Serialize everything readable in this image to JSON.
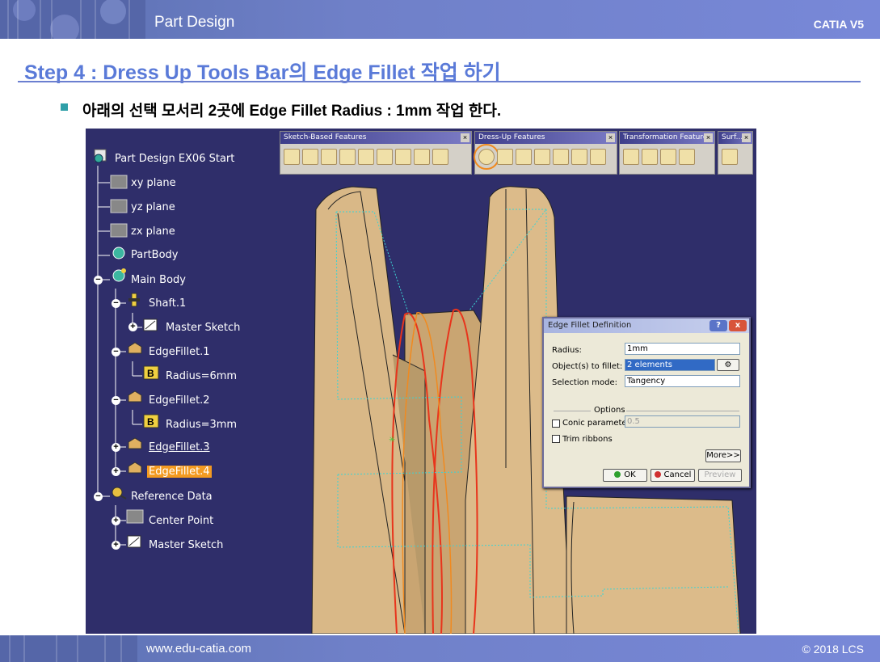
{
  "header": {
    "title": "Part Design",
    "product": "CATIA V5"
  },
  "step": {
    "title": "Step 4 : Dress Up Tools Bar의 Edge Fillet 작업 하기",
    "bullet": "아래의 선택 모서리 2곳에 Edge Fillet Radius : 1mm 작업 한다."
  },
  "tree": {
    "items": [
      {
        "label": "Part Design EX06 Start"
      },
      {
        "label": "xy plane"
      },
      {
        "label": "yz plane"
      },
      {
        "label": "zx plane"
      },
      {
        "label": "PartBody"
      },
      {
        "label": "Main Body"
      },
      {
        "label": "Shaft.1"
      },
      {
        "label": "Master Sketch"
      },
      {
        "label": "EdgeFillet.1"
      },
      {
        "label": "Radius=6mm"
      },
      {
        "label": "EdgeFillet.2"
      },
      {
        "label": "Radius=3mm"
      },
      {
        "label": "EdgeFillet.3"
      },
      {
        "label": "EdgeFillet.4"
      },
      {
        "label": "Reference Data"
      },
      {
        "label": "Center Point"
      },
      {
        "label": "Master Sketch"
      }
    ]
  },
  "toolbars": [
    {
      "title": "Sketch-Based Features"
    },
    {
      "title": "Dress-Up Features"
    },
    {
      "title": "Transformation Features"
    },
    {
      "title": "Surf..."
    }
  ],
  "dialog": {
    "title": "Edge Fillet Definition",
    "help": "?",
    "close": "x",
    "radius_label": "Radius:",
    "radius_value": "1mm",
    "objects_label": "Object(s) to fillet:",
    "objects_value": "2 elements",
    "selection_label": "Selection mode:",
    "selection_value": "Tangency",
    "options_label": "Options",
    "conic_label": "Conic parameter:",
    "conic_value": "0.5",
    "trim_label": "Trim ribbons",
    "more_label": "More>>",
    "ok_label": "OK",
    "cancel_label": "Cancel",
    "preview_label": "Preview"
  },
  "footer": {
    "url": "www.edu-catia.com",
    "copyright": "© 2018 LCS"
  },
  "colors": {
    "header_blue": "#6f80c8",
    "title_blue": "#5a7ad8",
    "viewport_bg": "#2f2e6a",
    "part_tan": "#d9b887",
    "selected_orange": "#f39a21",
    "edge_red": "#e8341c",
    "dialog_bg": "#ece9d8"
  }
}
